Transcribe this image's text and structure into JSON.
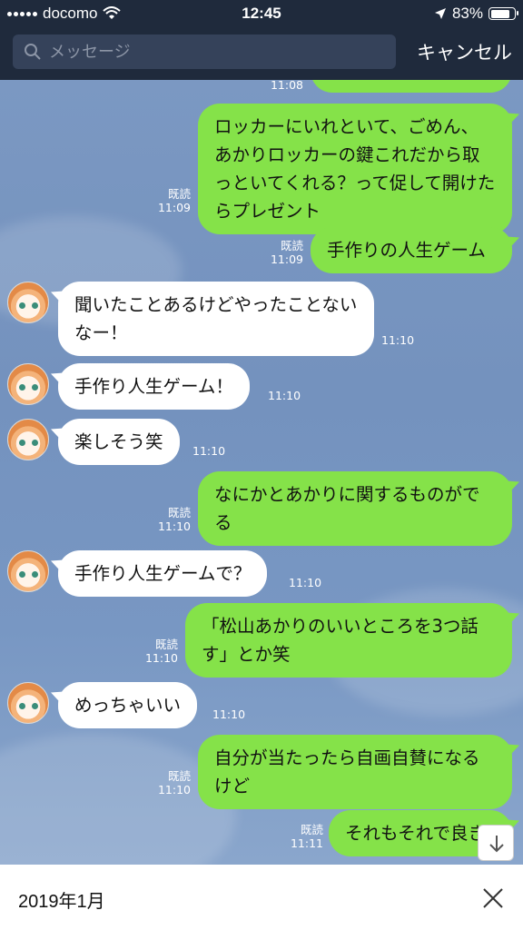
{
  "status_bar": {
    "carrier": "docomo",
    "time": "12:45",
    "battery": "83%",
    "battery_level": 0.83
  },
  "search": {
    "placeholder": "メッセージ",
    "value": "",
    "cancel_label": "キャンセル"
  },
  "read_label": "既読",
  "messages": [
    {
      "dir": "out",
      "text": "",
      "time": "11:08",
      "read": false
    },
    {
      "dir": "out",
      "text": "ロッカーにいれといて、ごめん、あかりロッカーの鍵これだから取っといてくれる？って促して開けたらプレゼント",
      "time": "11:09",
      "read": true
    },
    {
      "dir": "out",
      "text": "手作りの人生ゲーム",
      "time": "11:09",
      "read": true
    },
    {
      "dir": "in",
      "text": "聞いたことあるけどやったことないなー！",
      "time": "11:10"
    },
    {
      "dir": "in",
      "text": "手作り人生ゲーム！",
      "time": "11:10"
    },
    {
      "dir": "in",
      "text": "楽しそう笑",
      "time": "11:10"
    },
    {
      "dir": "out",
      "text": "なにかとあかりに関するものがでる",
      "time": "11:10",
      "read": true
    },
    {
      "dir": "in",
      "text": "手作り人生ゲームで？",
      "time": "11:10"
    },
    {
      "dir": "out",
      "text": "「松山あかりのいいところを3つ話す」とか笑",
      "time": "11:10",
      "read": true
    },
    {
      "dir": "in",
      "text": "めっちゃいい",
      "time": "11:10"
    },
    {
      "dir": "out",
      "text": "自分が当たったら自画自賛になるけど",
      "time": "11:10",
      "read": true
    },
    {
      "dir": "out",
      "text": "それもそれで良き",
      "time": "11:11",
      "read": true
    }
  ],
  "footer": {
    "date": "2019年1月"
  },
  "colors": {
    "chat_bg": "#7494c0",
    "bubble_out": "#85e249",
    "bubble_in": "#ffffff",
    "header_bg": "#1f2a3c"
  }
}
